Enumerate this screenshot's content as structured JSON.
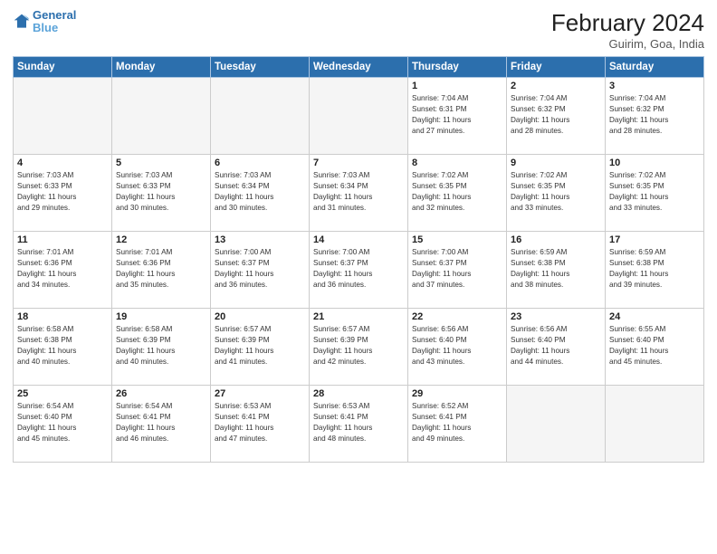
{
  "header": {
    "logo_line1": "General",
    "logo_line2": "Blue",
    "month_title": "February 2024",
    "location": "Guirim, Goa, India"
  },
  "days_of_week": [
    "Sunday",
    "Monday",
    "Tuesday",
    "Wednesday",
    "Thursday",
    "Friday",
    "Saturday"
  ],
  "weeks": [
    [
      {
        "day": "",
        "info": ""
      },
      {
        "day": "",
        "info": ""
      },
      {
        "day": "",
        "info": ""
      },
      {
        "day": "",
        "info": ""
      },
      {
        "day": "1",
        "info": "Sunrise: 7:04 AM\nSunset: 6:31 PM\nDaylight: 11 hours\nand 27 minutes."
      },
      {
        "day": "2",
        "info": "Sunrise: 7:04 AM\nSunset: 6:32 PM\nDaylight: 11 hours\nand 28 minutes."
      },
      {
        "day": "3",
        "info": "Sunrise: 7:04 AM\nSunset: 6:32 PM\nDaylight: 11 hours\nand 28 minutes."
      }
    ],
    [
      {
        "day": "4",
        "info": "Sunrise: 7:03 AM\nSunset: 6:33 PM\nDaylight: 11 hours\nand 29 minutes."
      },
      {
        "day": "5",
        "info": "Sunrise: 7:03 AM\nSunset: 6:33 PM\nDaylight: 11 hours\nand 30 minutes."
      },
      {
        "day": "6",
        "info": "Sunrise: 7:03 AM\nSunset: 6:34 PM\nDaylight: 11 hours\nand 30 minutes."
      },
      {
        "day": "7",
        "info": "Sunrise: 7:03 AM\nSunset: 6:34 PM\nDaylight: 11 hours\nand 31 minutes."
      },
      {
        "day": "8",
        "info": "Sunrise: 7:02 AM\nSunset: 6:35 PM\nDaylight: 11 hours\nand 32 minutes."
      },
      {
        "day": "9",
        "info": "Sunrise: 7:02 AM\nSunset: 6:35 PM\nDaylight: 11 hours\nand 33 minutes."
      },
      {
        "day": "10",
        "info": "Sunrise: 7:02 AM\nSunset: 6:35 PM\nDaylight: 11 hours\nand 33 minutes."
      }
    ],
    [
      {
        "day": "11",
        "info": "Sunrise: 7:01 AM\nSunset: 6:36 PM\nDaylight: 11 hours\nand 34 minutes."
      },
      {
        "day": "12",
        "info": "Sunrise: 7:01 AM\nSunset: 6:36 PM\nDaylight: 11 hours\nand 35 minutes."
      },
      {
        "day": "13",
        "info": "Sunrise: 7:00 AM\nSunset: 6:37 PM\nDaylight: 11 hours\nand 36 minutes."
      },
      {
        "day": "14",
        "info": "Sunrise: 7:00 AM\nSunset: 6:37 PM\nDaylight: 11 hours\nand 36 minutes."
      },
      {
        "day": "15",
        "info": "Sunrise: 7:00 AM\nSunset: 6:37 PM\nDaylight: 11 hours\nand 37 minutes."
      },
      {
        "day": "16",
        "info": "Sunrise: 6:59 AM\nSunset: 6:38 PM\nDaylight: 11 hours\nand 38 minutes."
      },
      {
        "day": "17",
        "info": "Sunrise: 6:59 AM\nSunset: 6:38 PM\nDaylight: 11 hours\nand 39 minutes."
      }
    ],
    [
      {
        "day": "18",
        "info": "Sunrise: 6:58 AM\nSunset: 6:38 PM\nDaylight: 11 hours\nand 40 minutes."
      },
      {
        "day": "19",
        "info": "Sunrise: 6:58 AM\nSunset: 6:39 PM\nDaylight: 11 hours\nand 40 minutes."
      },
      {
        "day": "20",
        "info": "Sunrise: 6:57 AM\nSunset: 6:39 PM\nDaylight: 11 hours\nand 41 minutes."
      },
      {
        "day": "21",
        "info": "Sunrise: 6:57 AM\nSunset: 6:39 PM\nDaylight: 11 hours\nand 42 minutes."
      },
      {
        "day": "22",
        "info": "Sunrise: 6:56 AM\nSunset: 6:40 PM\nDaylight: 11 hours\nand 43 minutes."
      },
      {
        "day": "23",
        "info": "Sunrise: 6:56 AM\nSunset: 6:40 PM\nDaylight: 11 hours\nand 44 minutes."
      },
      {
        "day": "24",
        "info": "Sunrise: 6:55 AM\nSunset: 6:40 PM\nDaylight: 11 hours\nand 45 minutes."
      }
    ],
    [
      {
        "day": "25",
        "info": "Sunrise: 6:54 AM\nSunset: 6:40 PM\nDaylight: 11 hours\nand 45 minutes."
      },
      {
        "day": "26",
        "info": "Sunrise: 6:54 AM\nSunset: 6:41 PM\nDaylight: 11 hours\nand 46 minutes."
      },
      {
        "day": "27",
        "info": "Sunrise: 6:53 AM\nSunset: 6:41 PM\nDaylight: 11 hours\nand 47 minutes."
      },
      {
        "day": "28",
        "info": "Sunrise: 6:53 AM\nSunset: 6:41 PM\nDaylight: 11 hours\nand 48 minutes."
      },
      {
        "day": "29",
        "info": "Sunrise: 6:52 AM\nSunset: 6:41 PM\nDaylight: 11 hours\nand 49 minutes."
      },
      {
        "day": "",
        "info": ""
      },
      {
        "day": "",
        "info": ""
      }
    ]
  ]
}
